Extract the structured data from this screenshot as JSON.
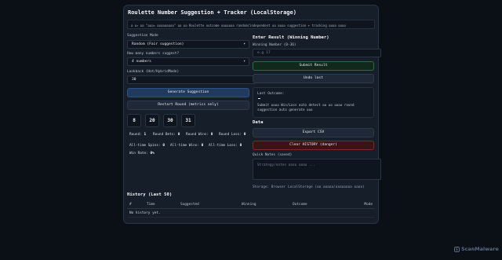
{
  "title": "Roulette Number Suggestion + Tracker (LocalStorage)",
  "note": "อ อะ ออ \"อออะ อออออออออ\" ออ ออ Roulette outcome อออออออ random/independent ออ ออออ suggestion + tracking ออออ ออออ",
  "suggestion": {
    "mode_label": "Suggestion Mode",
    "mode_value": "Random (Fair suggestion)",
    "count_label": "How many numbers suggest?",
    "count_value": "4 numbers",
    "lookback_label": "Lookback (Hot/HybridMode)",
    "lookback_value": "30",
    "generate_label": "Generate Suggestion",
    "restart_label": "Restart Round (metrics only)",
    "numbers": [
      "8",
      "20",
      "30",
      "31"
    ]
  },
  "stats": {
    "round_label": "Round:",
    "round_value": "1",
    "round_bets_label": "Round Bets:",
    "round_bets_value": "0",
    "round_wins_label": "Round Wins:",
    "round_wins_value": "0",
    "round_loss_label": "Round Loss:",
    "round_loss_value": "0",
    "alltime_spins_label": "All-time Spins:",
    "alltime_spins_value": "0",
    "alltime_wins_label": "All-time Wins:",
    "alltime_wins_value": "0",
    "alltime_loss_label": "All-time Loss:",
    "alltime_loss_value": "0",
    "winrate_label": "Win Rate:",
    "winrate_value": "0%"
  },
  "result": {
    "heading": "Enter Result (Winning Number)",
    "winning_label": "Winning Number (0-36)",
    "winning_placeholder": "e.g 17",
    "submit_label": "Submit Result",
    "undo_label": "Undo last",
    "last_outcome_label": "Last Outcome:",
    "last_outcome_desc_1": "Submit ออออ Win/Loss auto detect ออ ออ ออออ round",
    "last_outcome_desc_2": "suggestion auto generate อออ"
  },
  "data_section": {
    "heading": "Data",
    "export_label": "Export CSV",
    "clear_label": "Clear HISTORY (danger)",
    "notes_label": "Quick Notes (saved)",
    "notes_placeholder": "Strategy/notes ออออ ออออ ...",
    "storage_line": "Storage: Browser LocalStorage (ออ อออออ/ออออออออ ออออ)"
  },
  "history": {
    "heading": "History (Last 50)",
    "columns": [
      "#",
      "Time",
      "Suggested",
      "Winning",
      "Outcome",
      "Mode"
    ],
    "empty": "No history yet."
  },
  "watermark": "ScanMalware",
  "colors": {
    "background": "#0b1017",
    "card": "#161e2a",
    "primary": "#1f3a5c",
    "success_border": "#2e6b43",
    "danger": "#3a1414"
  }
}
